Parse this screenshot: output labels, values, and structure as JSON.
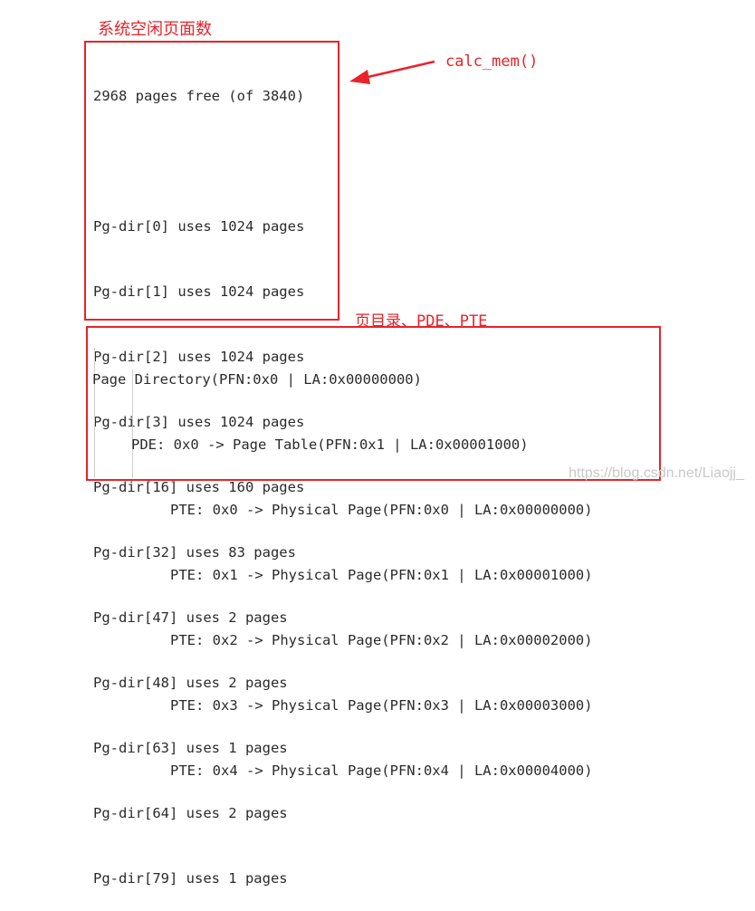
{
  "annotations": {
    "free_pages_title": "系统空闲页面数",
    "calc_mem_label": "calc_mem()",
    "directory_title": "页目录、PDE、PTE"
  },
  "free_summary": {
    "lines": [
      "2968 pages free (of 3840)",
      "",
      "Pg-dir[0] uses 1024 pages",
      "Pg-dir[1] uses 1024 pages",
      "Pg-dir[2] uses 1024 pages",
      "Pg-dir[3] uses 1024 pages",
      "Pg-dir[16] uses 160 pages",
      "Pg-dir[32] uses 83 pages",
      "Pg-dir[47] uses 2 pages",
      "Pg-dir[48] uses 2 pages",
      "Pg-dir[63] uses 1 pages",
      "Pg-dir[64] uses 2 pages",
      "Pg-dir[79] uses 1 pages"
    ]
  },
  "directory": {
    "page_directory": "Page Directory(PFN:0x0 | LA:0x00000000)",
    "pde": "PDE: 0x0 -> Page Table(PFN:0x1 | LA:0x00001000)",
    "ptes": [
      "PTE: 0x0 -> Physical Page(PFN:0x0 | LA:0x00000000)",
      "PTE: 0x1 -> Physical Page(PFN:0x1 | LA:0x00001000)",
      "PTE: 0x2 -> Physical Page(PFN:0x2 | LA:0x00002000)",
      "PTE: 0x3 -> Physical Page(PFN:0x3 | LA:0x00003000)",
      "PTE: 0x4 -> Physical Page(PFN:0x4 | LA:0x00004000)"
    ]
  },
  "watermark": "https://blog.csdn.net/Liaojj_",
  "colors": {
    "annotation_red": "#e8232a",
    "text": "#2b2b2b"
  }
}
